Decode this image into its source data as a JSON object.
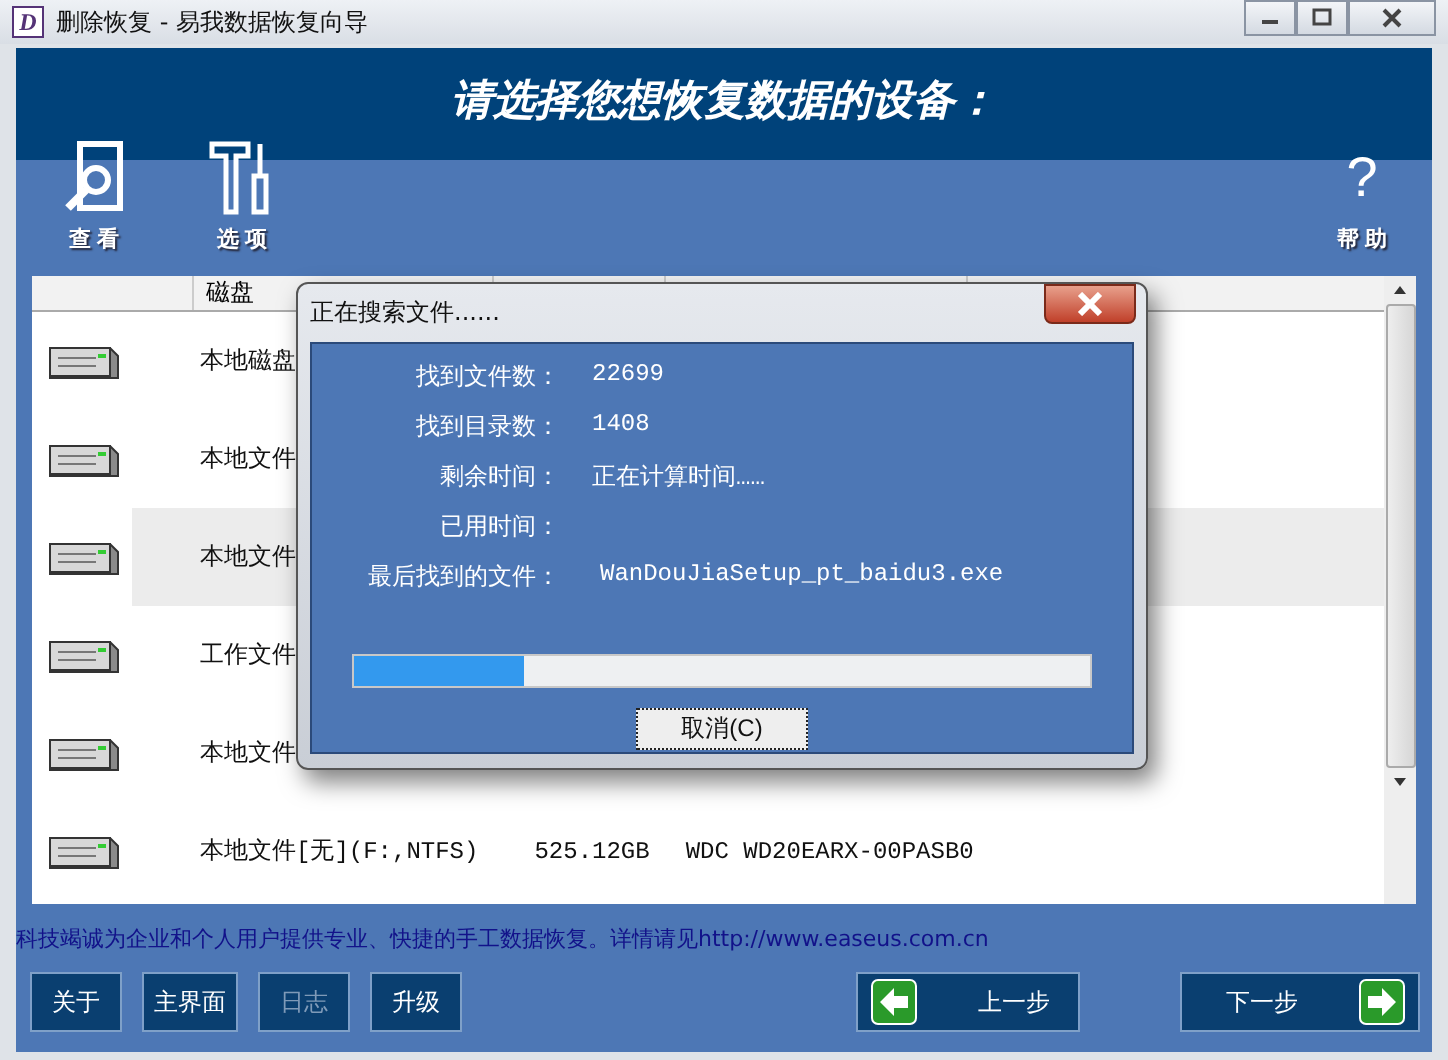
{
  "window": {
    "title": "删除恢复 - 易我数据恢复向导",
    "icon_letter": "D"
  },
  "header": {
    "title": "请选择您想恢复数据的设备："
  },
  "toolbar": [
    {
      "label": "查 看",
      "kind": "view"
    },
    {
      "label": "选 项",
      "kind": "options"
    },
    {
      "label": "帮 助",
      "kind": "help",
      "glyph": "?"
    }
  ],
  "disk_list": {
    "columns": [
      "磁盘"
    ],
    "rows": [
      {
        "cells": [
          "本地磁盘"
        ],
        "selected": false
      },
      {
        "cells": [
          "本地文件"
        ],
        "selected": false
      },
      {
        "cells": [
          "本地文件"
        ],
        "selected": true
      },
      {
        "cells": [
          "工作文件"
        ],
        "selected": false
      },
      {
        "cells": [
          "本地文件"
        ],
        "selected": false
      },
      {
        "cells": [
          "本地文件[无](F:,NTFS)",
          "525.12GB",
          "WDC WD20EARX-00PASB0"
        ],
        "selected": false
      }
    ]
  },
  "status_text": "科技竭诚为企业和个人用户提供专业、快捷的手工数据恢复。详情请见http://www.easeus.com.cn",
  "buttons": [
    {
      "label": "关于",
      "disabled": false
    },
    {
      "label": "主界面",
      "disabled": false
    },
    {
      "label": "日志",
      "disabled": true
    },
    {
      "label": "升级",
      "disabled": false
    }
  ],
  "nav": [
    {
      "label": "上一步",
      "kind": "back"
    },
    {
      "label": "下一步",
      "kind": "next"
    }
  ],
  "dialog": {
    "title": "正在搜索文件......",
    "fields": [
      {
        "label": "找到文件数：",
        "value": "22699"
      },
      {
        "label": "找到目录数：",
        "value": "1408"
      },
      {
        "label": "剩余时间：",
        "value": "正在计算时间……"
      },
      {
        "label": "已用时间："
      },
      {
        "label": "最后找到的文件：",
        "value": "WanDouJiaSetup_pt_baidu3.exe"
      }
    ],
    "progress": {
      "level": 0.23
    },
    "cancel": "取消(C)"
  }
}
